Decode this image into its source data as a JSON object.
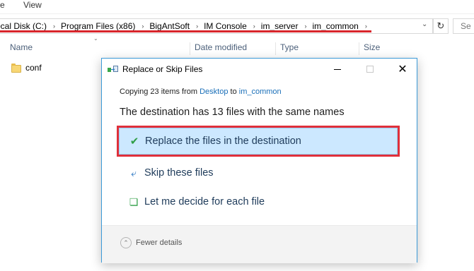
{
  "ribbon": {
    "tab_edge": "e",
    "tab_view": "View"
  },
  "address": {
    "crumbs": [
      "ocal Disk (C:)",
      "Program Files (x86)",
      "BigAntSoft",
      "IM Console",
      "im_server",
      "im_common"
    ],
    "separator": "›",
    "dropdown_icon": "chevron-down-icon",
    "refresh_icon": "refresh-icon",
    "search_placeholder": "Se"
  },
  "columns": {
    "name": "Name",
    "date": "Date modified",
    "type": "Type",
    "size": "Size"
  },
  "files": [
    {
      "name": "conf",
      "icon": "folder-icon"
    }
  ],
  "dialog": {
    "title": "Replace or Skip Files",
    "copying_prefix": "Copying 23 items from ",
    "source": "Desktop",
    "copying_middle": " to ",
    "destination": "im_common",
    "headline": "The destination has 13 files with the same names",
    "options": {
      "replace": "Replace the files in the destination",
      "skip": "Skip these files",
      "decide": "Let me decide for each file"
    },
    "fewer_details": "Fewer details",
    "highlight_color": "#e0303a",
    "accent_color": "#3c9ad8"
  }
}
